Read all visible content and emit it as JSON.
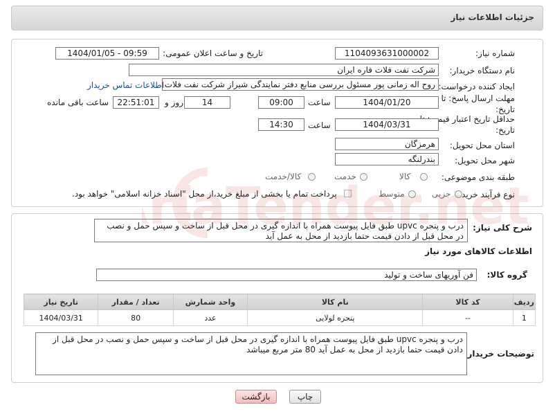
{
  "header": {
    "title": "جزئیات اطلاعات نیاز"
  },
  "form": {
    "need_number_label": "شماره نیاز:",
    "need_number": "1104093631000002",
    "announce_label": "تاریخ و ساعت اعلان عمومی:",
    "announce_value": "1404/01/05 - 09:59",
    "buyer_org_label": "نام دستگاه خریدار:",
    "buyer_org": "شرکت نفت فلات قاره ایران",
    "creator_label": "ایجاد کننده درخواست:",
    "creator": "روح اله زمانی پور مسئول بررسی منابع دفتر نمایندگی شیراز شرکت نفت فلات ق",
    "contact_link": "اطلاعات تماس خریدار",
    "deadline_label_1": "مهلت ارسال پاسخ: تا",
    "deadline_label_2": "تاریخ:",
    "deadline_date": "1404/01/20",
    "time_label": "ساعت",
    "deadline_time": "09:00",
    "days_value": "14",
    "days_label": "روز و",
    "remaining_time": "22:51:01",
    "remaining_label": "ساعت باقی مانده",
    "validity_label_1": "حداقل تاریخ اعتبار قیمت: تا",
    "validity_label_2": "تاریخ:",
    "validity_date": "1404/03/31",
    "validity_time_label": "ساعت",
    "validity_time": "14:30",
    "province_label": "استان محل تحویل:",
    "province": "هرمزگان",
    "city_label": "شهر محل تحویل:",
    "city": "بندرلنگه",
    "category_label": "طبقه بندی موضوعی:",
    "category_options": [
      "کالا",
      "خدمت",
      "کالا/خدمت"
    ],
    "process_label": "نوع فرآیند خرید :",
    "process_options": [
      "جزیی",
      "متوسط"
    ],
    "payment_note": "پرداخت تمام یا بخشی از مبلغ خرید،از محل \"اسناد خزانه اسلامی\" خواهد بود."
  },
  "details": {
    "summary_label": "شرح کلی نیاز:",
    "summary": "درب و پنجره upvc طبق فایل پیوست همراه با اندازه گیری در محل قبل از ساخت و سپس حمل و نصب در محل قبل از دادن قیمت حتما بازدید از محل به عمل آید",
    "goods_info_title": "اطلاعات کالاهای مورد نیاز",
    "goods_group_label": "گروه کالا:",
    "goods_group": "فن آوریهای ساخت و تولید",
    "table": {
      "headers": [
        "ردیف",
        "کد کالا",
        "نام کالا",
        "واحد شمارش",
        "تعداد / مقدار",
        "تاریخ نیاز"
      ],
      "rows": [
        [
          "1",
          "--",
          "پنجره لولایی",
          "عدد",
          "80",
          "1404/03/31"
        ]
      ]
    },
    "buyer_notes_label": "توضیحات خریدار:",
    "buyer_notes": "درب و پنجره upvc طبق فایل پیوست همراه با اندازه گیری در محل قبل از ساخت و سپس حمل و نصب در محل قبل از دادن قیمت حتما بازدید از محل به عمل آید 80 متر مربع میباشد"
  },
  "buttons": {
    "print": "چاپ",
    "back": "بازگشت"
  },
  "watermark": {
    "text": "AriaTender.net"
  }
}
